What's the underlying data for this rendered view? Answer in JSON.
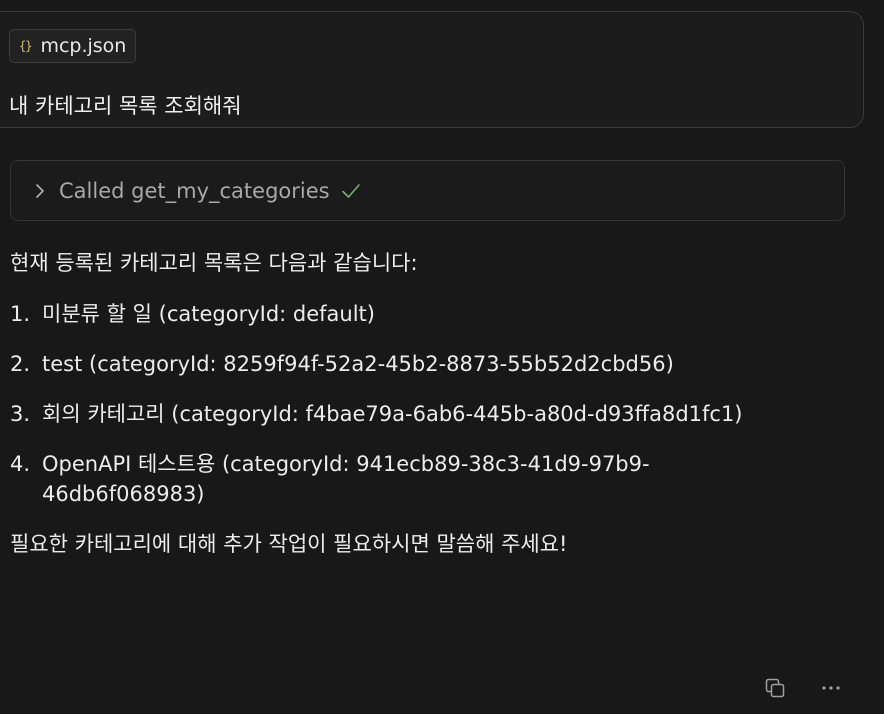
{
  "user_message": {
    "attachment": {
      "icon": "json-braces-icon",
      "icon_glyph": "{}",
      "name": "mcp.json"
    },
    "text": "내 카테고리 목록 조회해줘"
  },
  "tool_call": {
    "label": "Called get_my_categories",
    "status_icon": "checkmark-icon",
    "status_color": "#6fb36f"
  },
  "response": {
    "intro": "현재 등록된 카테고리 목록은 다음과 같습니다:",
    "items": [
      {
        "number": "1.",
        "text": "미분류 할 일 (categoryId: default)"
      },
      {
        "number": "2.",
        "text": "test (categoryId: 8259f94f-52a2-45b2-8873-55b52d2cbd56)"
      },
      {
        "number": "3.",
        "text": "회의 카테고리 (categoryId: f4bae79a-6ab6-445b-a80d-d93ffa8d1fc1)"
      },
      {
        "number": "4.",
        "text": "OpenAPI 테스트용 (categoryId: 941ecb89-38c3-41d9-97b9-46db6f068983)"
      }
    ],
    "outro": "필요한 카테고리에 대해 추가 작업이 필요하시면 말씀해 주세요!"
  },
  "actions": {
    "copy_icon": "copy-icon",
    "more_icon": "more-options-icon"
  }
}
